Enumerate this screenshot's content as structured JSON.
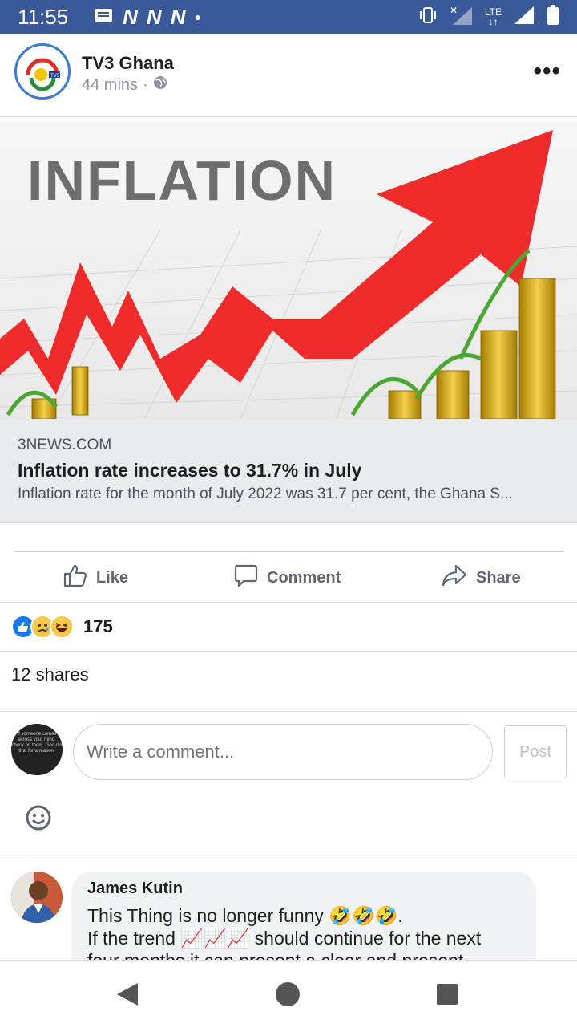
{
  "status_bar": {
    "time": "11:55",
    "network_label": "LTE"
  },
  "post": {
    "page_name": "TV3 Ghana",
    "time_ago": "44 mins",
    "separator": "·",
    "image_text": "INFLATION",
    "link": {
      "domain": "3NEWS.COM",
      "headline": "Inflation rate increases to 31.7% in July",
      "description": "Inflation rate for the month of July 2022 was 31.7 per cent, the Ghana S..."
    },
    "actions": {
      "like": "Like",
      "comment": "Comment",
      "share": "Share"
    },
    "reaction_count": "175",
    "shares": "12 shares"
  },
  "comment_box": {
    "placeholder": "Write a comment...",
    "post_label": "Post",
    "my_avatar_text": "If someone comes across your mind, check on them. God did that for a reason."
  },
  "comments": [
    {
      "author": "James Kutin",
      "line1": "This Thing is no longer funny 🤣🤣🤣.",
      "line2": "If the trend 📈📈📈 should continue for the next",
      "line3": "four months it can present a clear and present"
    }
  ],
  "colors": {
    "brand": "#3b5998",
    "link_bg": "#e9ebee",
    "arrow": "#ef2b2b"
  }
}
